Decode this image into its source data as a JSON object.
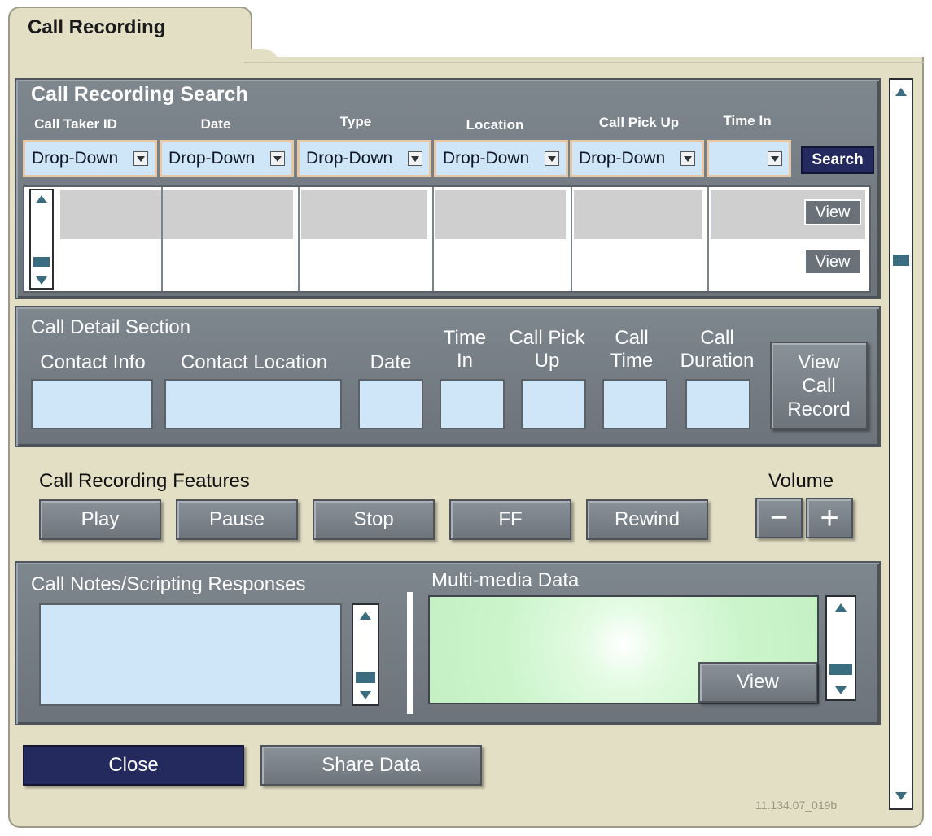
{
  "window": {
    "title": "Call Recording"
  },
  "search": {
    "title": "Call Recording Search",
    "columns": [
      "Call Taker ID",
      "Date",
      "Type",
      "Location",
      "Call Pick Up",
      "Time In"
    ],
    "dropdowns": [
      "Drop-Down",
      "Drop-Down",
      "Drop-Down",
      "Drop-Down",
      "Drop-Down",
      ""
    ],
    "search_button": "Search",
    "results": {
      "view_labels": [
        "View",
        "View"
      ]
    }
  },
  "detail": {
    "title": "Call Detail Section",
    "labels": [
      "Contact Info",
      "Contact Location",
      "Date",
      "Time In",
      "Call Pick Up",
      "Call Time",
      "Call Duration"
    ],
    "view_record_button": "View Call Record"
  },
  "features": {
    "title": "Call Recording Features",
    "buttons": [
      "Play",
      "Pause",
      "Stop",
      "FF",
      "Rewind"
    ],
    "volume": {
      "label": "Volume",
      "minus": "−",
      "plus": "+"
    }
  },
  "notes": {
    "title": "Call Notes/Scripting Responses"
  },
  "media": {
    "title": "Multi-media Data",
    "view_button": "View"
  },
  "footer": {
    "close_button": "Close",
    "share_button": "Share Data",
    "figure_id": "11.134.07_019b"
  }
}
